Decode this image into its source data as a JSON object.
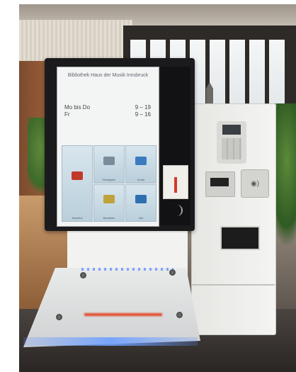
{
  "kiosk": {
    "screen_title": "Bibliothek Haus der Musik Innsbruck",
    "hours": [
      {
        "days": "Mo bis Do",
        "time": "9 – 19"
      },
      {
        "days": "Fr",
        "time": "9 – 16"
      }
    ],
    "tiles": [
      {
        "label": "Ausleihe",
        "icon": "books-icon",
        "color": "#c0392b"
      },
      {
        "label": "Rückgabe",
        "icon": "return-icon",
        "color": "#7a8b99"
      },
      {
        "label": "Konto",
        "icon": "account-icon",
        "color": "#3b7bbf"
      },
      {
        "label": "Bezahlen",
        "icon": "payment-icon",
        "color": "#c0a23b"
      },
      {
        "label": "Info",
        "icon": "info-icon",
        "color": "#2f6fb0"
      }
    ]
  }
}
